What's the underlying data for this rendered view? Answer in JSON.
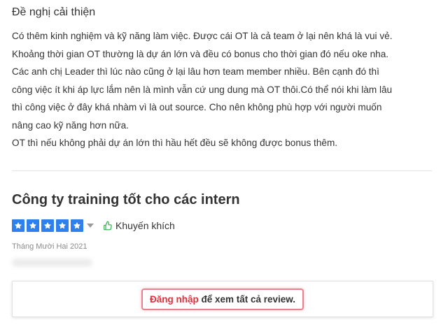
{
  "improvement": {
    "heading": "Đề nghị cải thiện",
    "lines": [
      "Có thêm kinh nghiệm và kỹ năng làm việc. Được cái OT là cả team ở lại nên khá là vui vẻ.",
      "Khoảng thời gian OT thường là dự án lớn và đều có bonus cho thời gian đó nếu oke nha.",
      "Các anh chị Leader thì lúc nào cũng ở lại lâu hơn team member nhiều. Bên cạnh đó thì",
      "công việc ít khi áp lực lắm nên là mình vẫn cứ ung dung mà OT thôi.Có thể nói khi làm lâu",
      "thì công việc ở đây khá nhàm vì là out source. Cho nên không phù hợp với người muốn",
      "nâng cao kỹ năng hơn nữa.",
      "OT thì nếu không phải dự án lớn thì hầu hết đều sẽ không được bonus thêm."
    ]
  },
  "next_review": {
    "title": "Công ty training tốt cho các intern",
    "rating": 5,
    "rating_max": 5,
    "star_color": "#2f80ed",
    "recommend_icon": "thumbs-up-icon",
    "recommend_label": "Khuyến khích",
    "date": "Tháng Mười Hai 2021"
  },
  "login_prompt": {
    "link_label": "Đăng nhập",
    "text": " để xem tất cả review.",
    "link_color": "#e0303a"
  }
}
